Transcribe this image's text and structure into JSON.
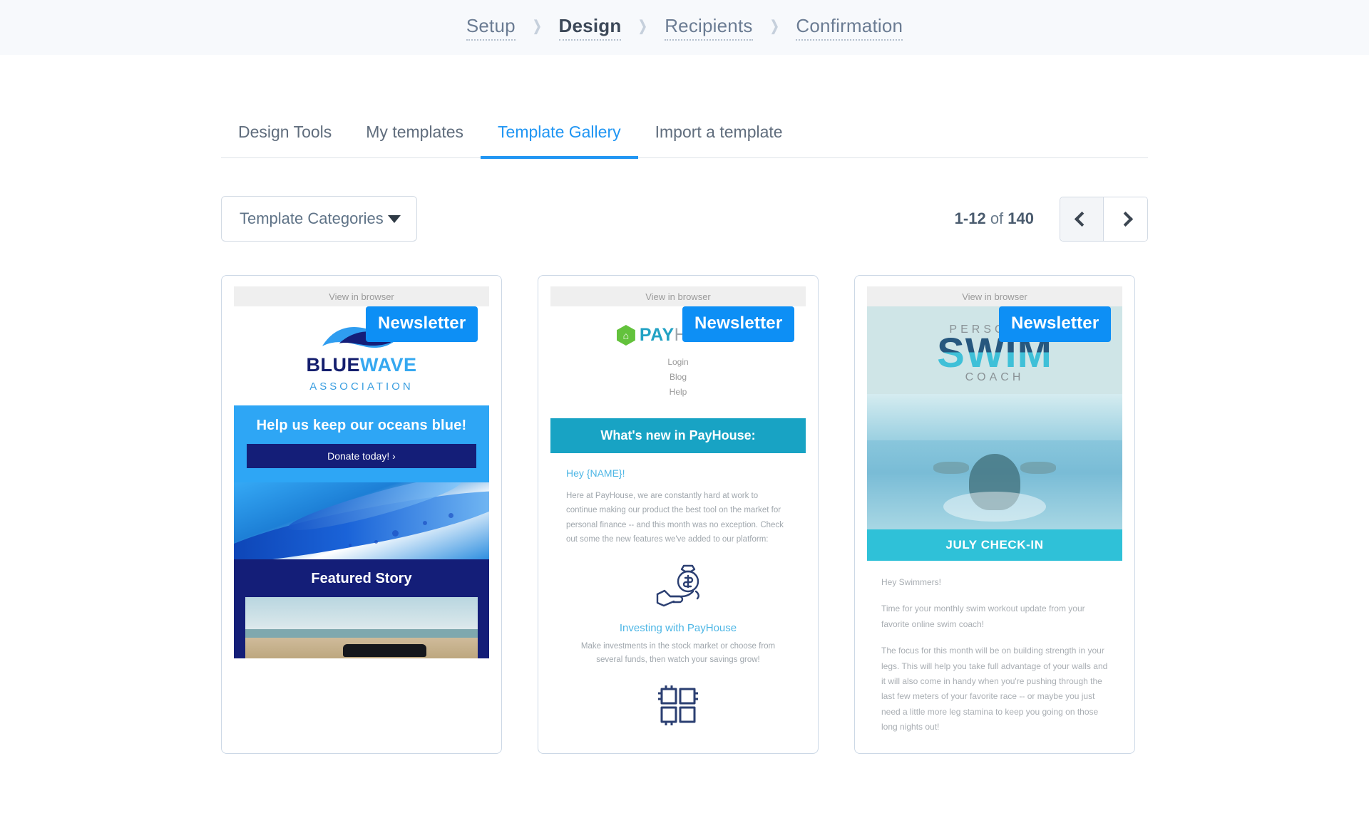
{
  "stepper": {
    "steps": [
      {
        "label": "Setup",
        "active": false
      },
      {
        "label": "Design",
        "active": true
      },
      {
        "label": "Recipients",
        "active": false
      },
      {
        "label": "Confirmation",
        "active": false
      }
    ],
    "separator": "❯"
  },
  "tabs": [
    {
      "label": "Design Tools",
      "active": false
    },
    {
      "label": "My templates",
      "active": false
    },
    {
      "label": "Template Gallery",
      "active": true
    },
    {
      "label": "Import a template",
      "active": false
    }
  ],
  "toolbar": {
    "category_select": {
      "label": "Template Categories",
      "icon": "chevron-down-icon"
    },
    "pagination": {
      "range": "1-12",
      "of": " of ",
      "total": "140",
      "prev_icon": "chevron-left-icon",
      "next_icon": "chevron-right-icon"
    }
  },
  "colors": {
    "accent": "#2196f3",
    "badge": "#0d8ff5",
    "step_active": "#3c4858",
    "header_bg": "#f7f9fc"
  },
  "templates": [
    {
      "badge": "Newsletter",
      "view_in_browser": "View in browser",
      "brand": {
        "name_part1": "BLUE",
        "name_part2": "WAVE",
        "subtitle": "ASSOCIATION"
      },
      "hero_heading": "Help us keep our oceans blue!",
      "cta": "Donate today! ›",
      "featured_heading": "Featured Story"
    },
    {
      "badge": "Newsletter",
      "view_in_browser": "View in browser",
      "brand": {
        "icon_letter": "⌂",
        "name_part1": "PAY",
        "name_part2": "HOUSE"
      },
      "nav": [
        "Login",
        "Blog",
        "Help"
      ],
      "band_heading": "What's new in PayHouse:",
      "greeting": "Hey  {NAME}!",
      "paragraph": "Here at PayHouse, we are constantly hard at work to continue making our product the best tool on the market for personal finance -- and this month was no exception. Check out some the new features we've added to our platform:",
      "feature_title": "Investing with PayHouse",
      "feature_text": "Make investments in the stock market or choose from several funds, then watch your savings grow!"
    },
    {
      "badge": "Newsletter",
      "view_in_browser": "View in browser",
      "brand": {
        "line1": "PERSONAL",
        "line2": "SWIM",
        "line3": "COACH"
      },
      "band_heading": "JULY CHECK-IN",
      "greeting": "Hey Swimmers!",
      "paragraph1": "Time for your monthly swim workout update from your favorite online swim coach!",
      "paragraph2": "The focus for this month will be on building strength in your legs. This will help you take full advantage of your walls and it will also come in handy when you're pushing through the last few meters of your favorite race -- or maybe you just need a little more leg stamina to keep you going on those long nights out!"
    }
  ]
}
